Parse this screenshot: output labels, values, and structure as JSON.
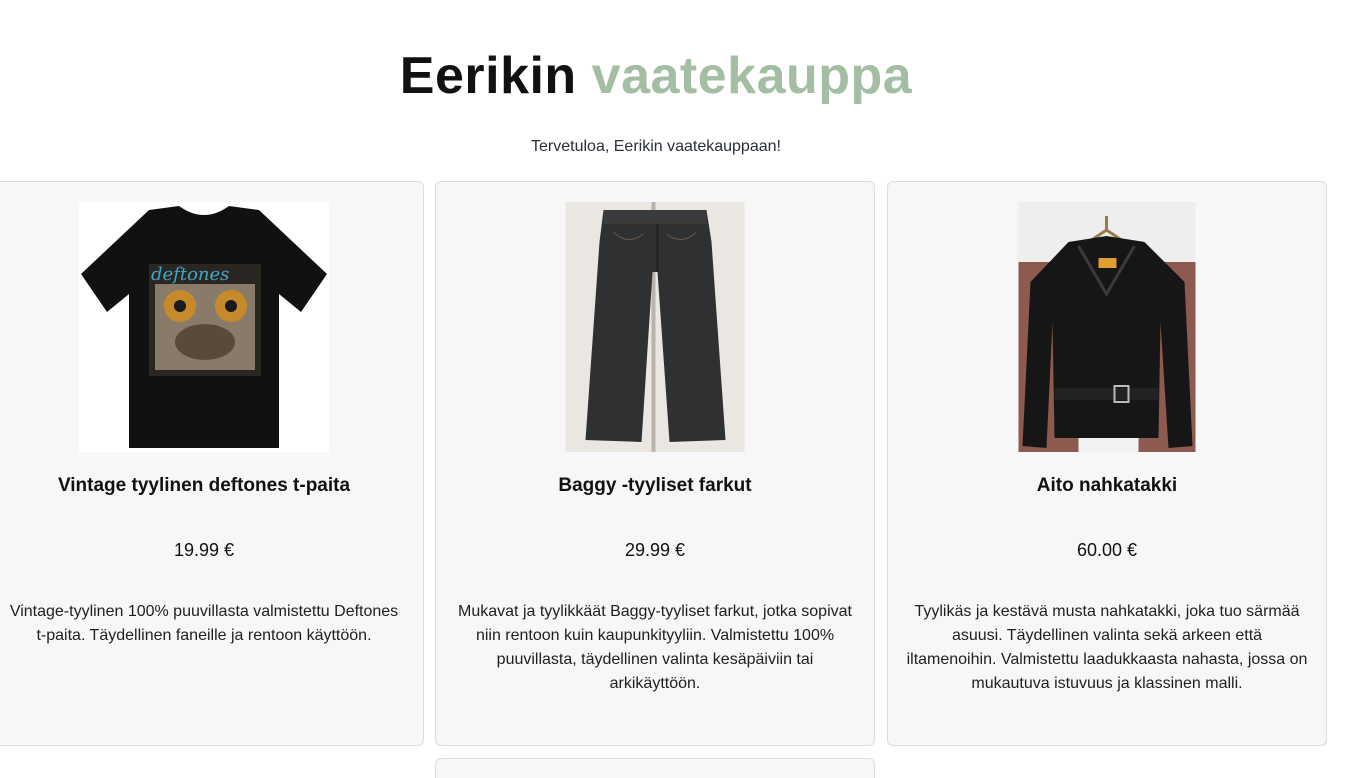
{
  "header": {
    "title_part1": "Eerikin",
    "title_part2": "vaatekauppa",
    "accent_color": "#a3bea3",
    "welcome": "Tervetuloa, Eerikin vaatekauppaan!"
  },
  "products": [
    {
      "image_icon": "tshirt-image",
      "name": "Vintage tyylinen deftones t-paita",
      "price": "19.99 €",
      "description": "Vintage-tyylinen 100% puuvillasta valmistettu Deftones t-paita. Täydellinen faneille ja rentoon käyttöön.",
      "print_text": "deftones"
    },
    {
      "image_icon": "jeans-image",
      "name": "Baggy -tyyliset farkut",
      "price": "29.99 €",
      "description": "Mukavat ja tyylikkäät Baggy-tyyliset farkut, jotka sopivat niin rentoon kuin kaupunkityyliin. Valmistettu 100% puuvillasta, täydellinen valinta kesäpäiviin tai arkikäyttöön."
    },
    {
      "image_icon": "leather-jacket-image",
      "name": "Aito nahkatakki",
      "price": "60.00 €",
      "description": "Tyylikäs ja kestävä musta nahkatakki, joka tuo särmää asuusi. Täydellinen valinta sekä arkeen että iltamenoihin. Valmistettu laadukkaasta nahasta, jossa on mukautuva istuvuus ja klassinen malli."
    }
  ]
}
